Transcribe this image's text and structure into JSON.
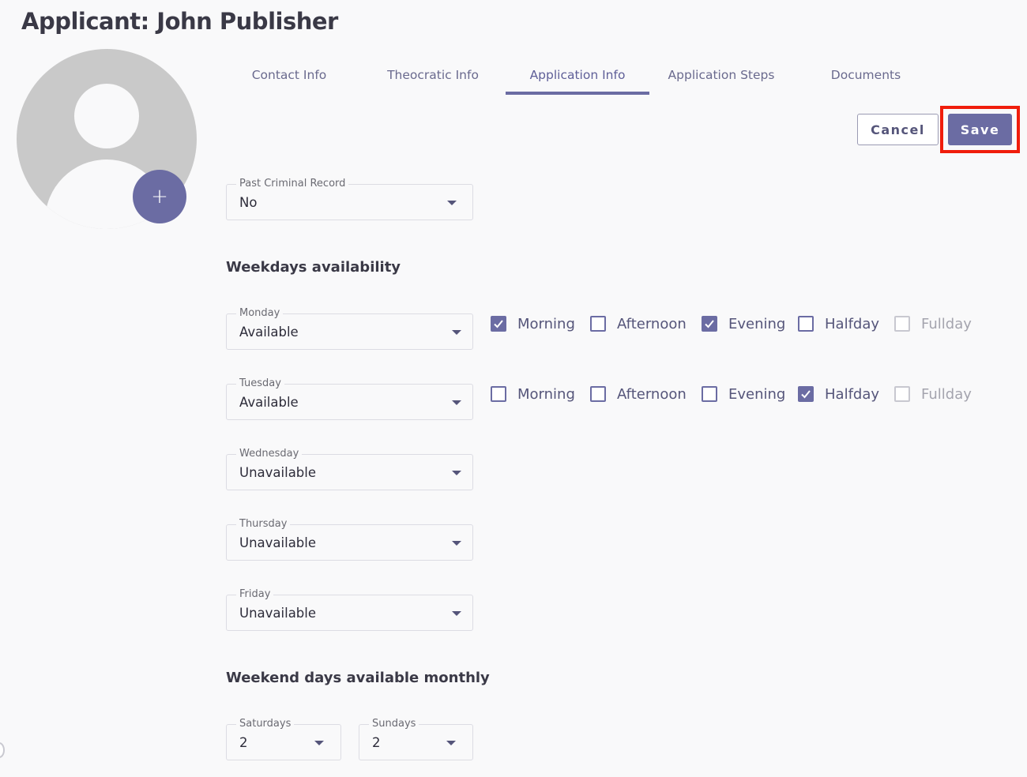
{
  "page": {
    "title": "Applicant: John Publisher"
  },
  "avatar": {
    "add_label": "+"
  },
  "tabs": [
    {
      "label": "Contact Info"
    },
    {
      "label": "Theocratic Info"
    },
    {
      "label": "Application Info",
      "active": true
    },
    {
      "label": "Application Steps"
    },
    {
      "label": "Documents"
    }
  ],
  "actions": {
    "cancel_label": "Cancel",
    "save_label": "Save"
  },
  "criminal": {
    "label": "Past Criminal Record",
    "value": "No"
  },
  "weekdays": {
    "heading": "Weekdays availability",
    "days": [
      {
        "label": "Monday",
        "value": "Available",
        "slots": [
          {
            "label": "Morning",
            "checked": true,
            "disabled": false
          },
          {
            "label": "Afternoon",
            "checked": false,
            "disabled": false
          },
          {
            "label": "Evening",
            "checked": true,
            "disabled": false
          },
          {
            "label": "Halfday",
            "checked": false,
            "disabled": false
          },
          {
            "label": "Fullday",
            "checked": false,
            "disabled": true
          }
        ]
      },
      {
        "label": "Tuesday",
        "value": "Available",
        "slots": [
          {
            "label": "Morning",
            "checked": false,
            "disabled": false
          },
          {
            "label": "Afternoon",
            "checked": false,
            "disabled": false
          },
          {
            "label": "Evening",
            "checked": false,
            "disabled": false
          },
          {
            "label": "Halfday",
            "checked": true,
            "disabled": false
          },
          {
            "label": "Fullday",
            "checked": false,
            "disabled": true
          }
        ]
      },
      {
        "label": "Wednesday",
        "value": "Unavailable"
      },
      {
        "label": "Thursday",
        "value": "Unavailable"
      },
      {
        "label": "Friday",
        "value": "Unavailable"
      }
    ]
  },
  "weekend": {
    "heading": "Weekend days available monthly",
    "saturdays": {
      "label": "Saturdays",
      "value": "2"
    },
    "sundays": {
      "label": "Sundays",
      "value": "2"
    }
  },
  "colors": {
    "accent": "#6b6ca3",
    "highlight": "#f01d0b"
  }
}
